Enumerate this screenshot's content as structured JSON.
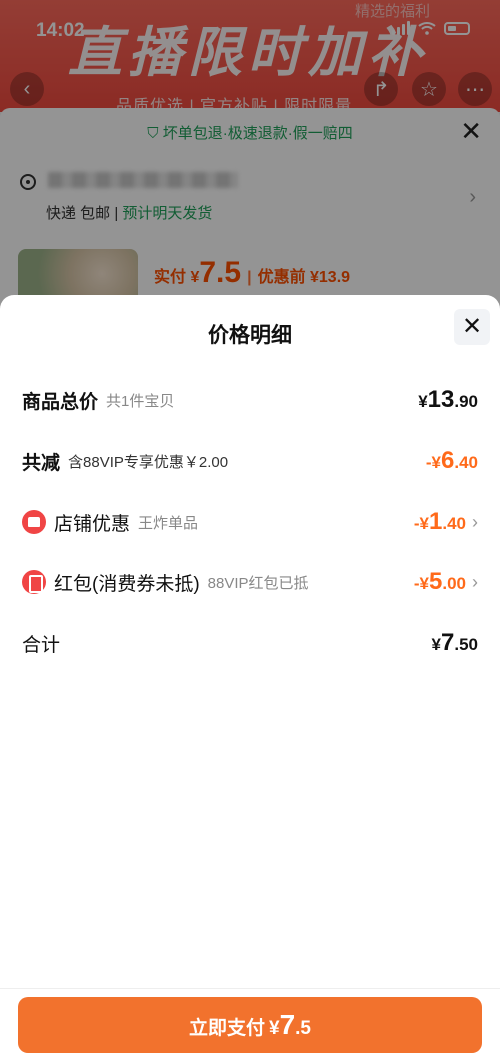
{
  "status_bar": {
    "time": "14:02"
  },
  "background": {
    "banner_text": "直播限时加补",
    "banner_tag": "精选的福利",
    "slogan": "品质优选 | 官方补贴 | 限时限量",
    "guarantee": "坏单包退·极速退款·假一赔四",
    "shipping_prefix": "快递 包邮 | ",
    "shipping_eta": "预计明天发货",
    "paid_label": "实付 ¥",
    "paid_value": "7.5",
    "before_discount": "优惠前 ¥13.9"
  },
  "sheet": {
    "title": "价格明细",
    "rows": [
      {
        "label": "商品总价",
        "sub": "共1件宝贝",
        "sym": "¥",
        "int": "13",
        "dec": ".90"
      },
      {
        "label": "共减",
        "sub": "含88VIP专享优惠￥2.00",
        "sym": "-¥",
        "int": "6",
        "dec": ".40"
      },
      {
        "label": "店铺优惠",
        "sub": "王炸单品",
        "sym": "-¥",
        "int": "1",
        "dec": ".40"
      },
      {
        "label": "红包(消费券未抵)",
        "sub": "88VIP红包已抵",
        "sym": "-¥",
        "int": "5",
        "dec": ".00"
      },
      {
        "label": "合计",
        "sub": "",
        "sym": "¥",
        "int": "7",
        "dec": ".50"
      }
    ]
  },
  "pay_button": {
    "label": "立即支付",
    "sym": "¥",
    "int": "7",
    "dec": ".5"
  },
  "colors": {
    "accent": "#f2722d",
    "discount": "#ff6a1a",
    "green": "#1fa05a"
  }
}
